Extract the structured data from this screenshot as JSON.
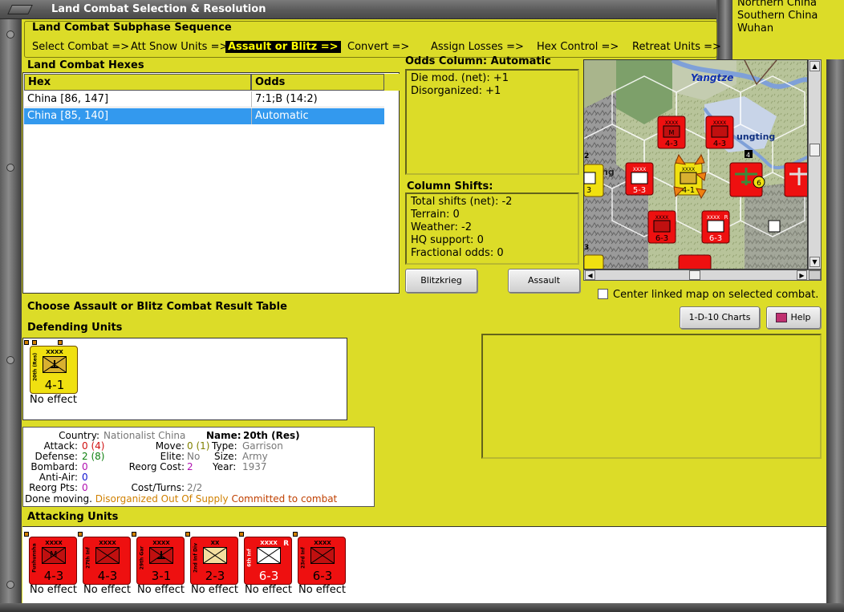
{
  "window": {
    "title": "Land Combat Selection & Resolution"
  },
  "regions": [
    "Northern China",
    "Southern China",
    "Wuhan"
  ],
  "subphase": {
    "title": "Land Combat Subphase Sequence",
    "steps": [
      {
        "label": "Select Combat =>",
        "active": false
      },
      {
        "label": "Att Snow Units =>",
        "active": false
      },
      {
        "label": "Assault or Blitz =>",
        "active": true
      },
      {
        "label": "Convert =>",
        "active": false
      },
      {
        "label": "Assign Losses =>",
        "active": false
      },
      {
        "label": "Hex Control =>",
        "active": false
      },
      {
        "label": "Retreat Units =>",
        "active": false
      }
    ]
  },
  "hexes": {
    "title": "Land Combat Hexes",
    "columns": [
      "Hex",
      "Odds"
    ],
    "rows": [
      {
        "hex": "China [86, 147]",
        "odds": "7:1;B (14:2)",
        "selected": false
      },
      {
        "hex": "China [85, 140]",
        "odds": "Automatic",
        "selected": true
      }
    ]
  },
  "odds": {
    "title": "Odds Column: Automatic",
    "lines": [
      "Die mod. (net): +1",
      "Disorganized: +1"
    ]
  },
  "shifts": {
    "title": "Column Shifts:",
    "lines": [
      "Total shifts (net): -2",
      "Terrain: 0",
      "Weather: -2",
      "HQ support: 0",
      "Fractional odds: 0"
    ]
  },
  "buttons": {
    "blitzkrieg": "Blitzkrieg",
    "assault": "Assault",
    "charts": "1-D-10 Charts",
    "help": "Help"
  },
  "map": {
    "river_label": "Yangtze",
    "city_label": "ungting",
    "extra_label": "ng"
  },
  "center_linked_label": "Center linked map on selected combat.",
  "crt_prompt": "Choose Assault or Blitz Combat Result Table",
  "defending": {
    "title": "Defending Units",
    "units": [
      {
        "name": "20th (Res)",
        "size": "XXXX",
        "strength": "4-1",
        "effect": "No effect"
      }
    ]
  },
  "unit_info": {
    "country_label": "Country:",
    "country": "Nationalist China",
    "name_label": "Name:",
    "name": "20th (Res)",
    "attack_label": "Attack:",
    "attack": "0",
    "attack_paren": "(4)",
    "defense_label": "Defense:",
    "defense": "2",
    "defense_paren": "(8)",
    "bombard_label": "Bombard:",
    "bombard": "0",
    "antiair_label": "Anti-Air:",
    "antiair": "0",
    "reorgpts_label": "Reorg Pts:",
    "reorgpts": "0",
    "move_label": "Move:",
    "move": "0",
    "move_paren": "(1)",
    "type_label": "Type:",
    "type": "Garrison",
    "elite_label": "Elite:",
    "elite": "No",
    "size_label": "Size:",
    "size": "Army",
    "reorgcost_label": "Reorg Cost:",
    "reorgcost": "2",
    "year_label": "Year:",
    "year": "1937",
    "costturns_label": "Cost/Turns:",
    "costturns": "2/2",
    "status_done": "Done moving.",
    "status_disorg": "Disorganized",
    "status_supply": "Out Of Supply",
    "status_committed": "Committed to combat"
  },
  "attacking": {
    "title": "Attacking Units",
    "units": [
      {
        "name": "Fushunsha",
        "size": "XXXX",
        "strength": "4-3",
        "effect": "No effect",
        "sym": "M",
        "reserve": false
      },
      {
        "name": "27th Inf",
        "size": "XXXX",
        "strength": "4-3",
        "effect": "No effect",
        "sym": "",
        "reserve": false
      },
      {
        "name": "29th Gar",
        "size": "XXXX",
        "strength": "3-1",
        "effect": "No effect",
        "sym": "",
        "reserve": false
      },
      {
        "name": "2nd Inf Div",
        "size": "XX",
        "strength": "2-3",
        "effect": "No effect",
        "sym": "",
        "reserve": false
      },
      {
        "name": "6th Inf",
        "size": "XXXX",
        "strength": "6-3",
        "effect": "No effect",
        "sym": "",
        "reserve": true
      },
      {
        "name": "23rd Inf",
        "size": "XXXX",
        "strength": "6-3",
        "effect": "No effect",
        "sym": "",
        "reserve": false
      }
    ]
  },
  "map_units": [
    {
      "size": "XXXX",
      "strength": "4-3",
      "sym": "M"
    },
    {
      "size": "XXXX",
      "strength": "4-3",
      "sym": ""
    },
    {
      "size": "XXXX",
      "strength": "5-3",
      "sym": ""
    },
    {
      "size": "XXXX",
      "strength": "4-1",
      "sym": ""
    },
    {
      "size": "XXXX",
      "strength": "6-3",
      "sym": ""
    },
    {
      "size": "XXXX",
      "strength": "6-3",
      "sym": ""
    }
  ],
  "map_badges": {
    "air_count": "6",
    "stack_a": "4",
    "stack_b": "2",
    "stack_c": "3",
    "left_strength": "3",
    "reserve_mark": "R"
  },
  "colors": {
    "panel": "#dcdc28",
    "attacker": "#ee1010",
    "defender": "#f0e010",
    "selection": "#3399ee"
  }
}
